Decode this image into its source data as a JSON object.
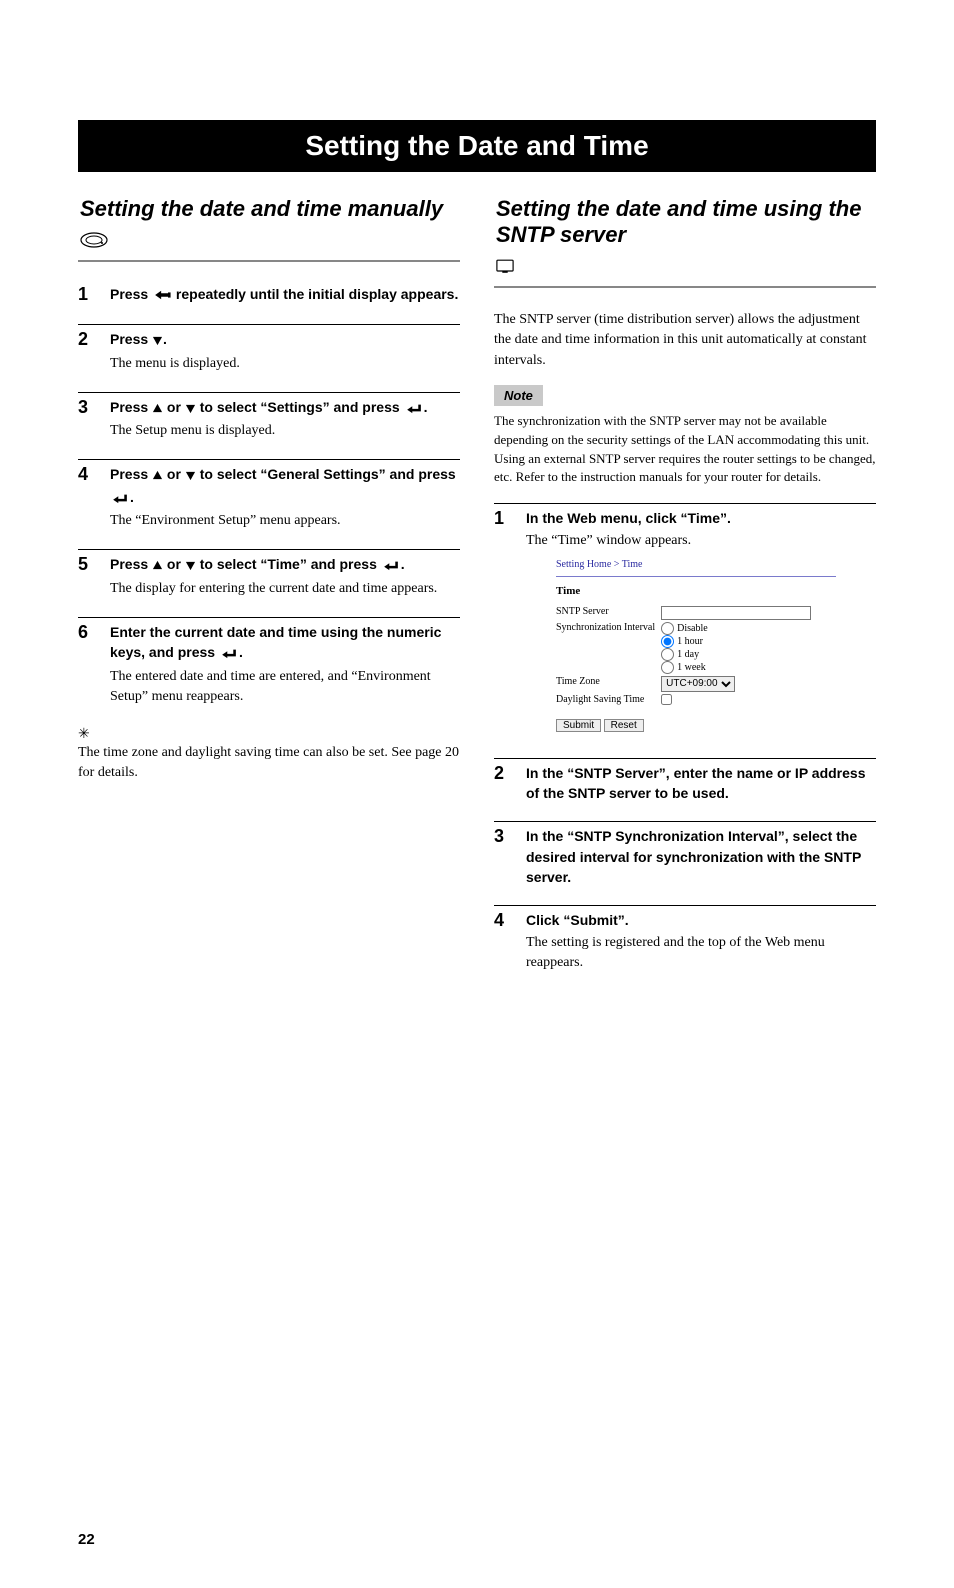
{
  "page_title": "Setting the Date and Time",
  "page_number": "22",
  "left": {
    "heading": "Setting the date and time manually",
    "steps": [
      {
        "num": "1",
        "instr_pre": "Press ",
        "instr_post": " repeatedly until the initial display appears.",
        "icon": "back",
        "result": ""
      },
      {
        "num": "2",
        "instr_pre": "Press ",
        "instr_post": ".",
        "icon": "down",
        "result": "The menu is displayed."
      },
      {
        "num": "3",
        "instr_pre": "Press ",
        "instr_mid": " or ",
        "instr_mid2": " to select “Settings” and press ",
        "instr_post": ".",
        "icon1": "up",
        "icon2": "down",
        "icon3": "enter",
        "result": "The Setup menu is displayed."
      },
      {
        "num": "4",
        "instr_pre": "Press ",
        "instr_mid": " or ",
        "instr_mid2": " to select “General Settings” and press ",
        "instr_post": ".",
        "icon1": "up",
        "icon2": "down",
        "icon3": "enter",
        "result": "The “Environment Setup” menu appears."
      },
      {
        "num": "5",
        "instr_pre": "Press ",
        "instr_mid": " or ",
        "instr_mid2": " to select “Time” and press ",
        "instr_post": ".",
        "icon1": "up",
        "icon2": "down",
        "icon3": "enter",
        "result": "The display for entering the current date and time appears."
      },
      {
        "num": "6",
        "instr_pre": "Enter the current date and time using the numeric keys, and press ",
        "instr_post": ".",
        "icon": "enter",
        "result": "The entered date and time are entered, and “Environment Setup” menu reappears."
      }
    ],
    "tip": "The time zone and daylight saving time can also be set. See page 20 for details."
  },
  "right": {
    "heading": "Setting the date and time using the SNTP server",
    "intro": "The SNTP server (time distribution server) allows the adjustment the date and time information in this unit automatically at constant intervals.",
    "note_label": "Note",
    "note_text": "The synchronization with the SNTP server may not be available depending on the security settings of the LAN accommodating this unit. Using an external SNTP server requires the router settings to be changed, etc. Refer to the instruction manuals for your router for details.",
    "steps": [
      {
        "num": "1",
        "instr": "In the Web menu, click “Time”.",
        "result": "The “Time” window appears."
      },
      {
        "num": "2",
        "instr": "In the “SNTP Server”, enter the name or IP address of the SNTP server to be used.",
        "result": ""
      },
      {
        "num": "3",
        "instr": "In the “SNTP Synchronization Interval”, select the desired interval for synchronization with the SNTP server.",
        "result": ""
      },
      {
        "num": "4",
        "instr": "Click “Submit”.",
        "result": "The setting is registered and the top of the Web menu reappears."
      }
    ],
    "screenshot": {
      "crumb": "Setting Home > Time",
      "section": "Time",
      "row_sntp": "SNTP Server",
      "row_sync": "Synchronization Interval",
      "sync_options": [
        "Disable",
        "1 hour",
        "1 day",
        "1 week"
      ],
      "sync_selected_index": 1,
      "row_tz": "Time Zone",
      "tz_value": "UTC+09:00",
      "row_dst": "Daylight Saving Time",
      "btn_submit": "Submit",
      "btn_reset": "Reset"
    }
  }
}
